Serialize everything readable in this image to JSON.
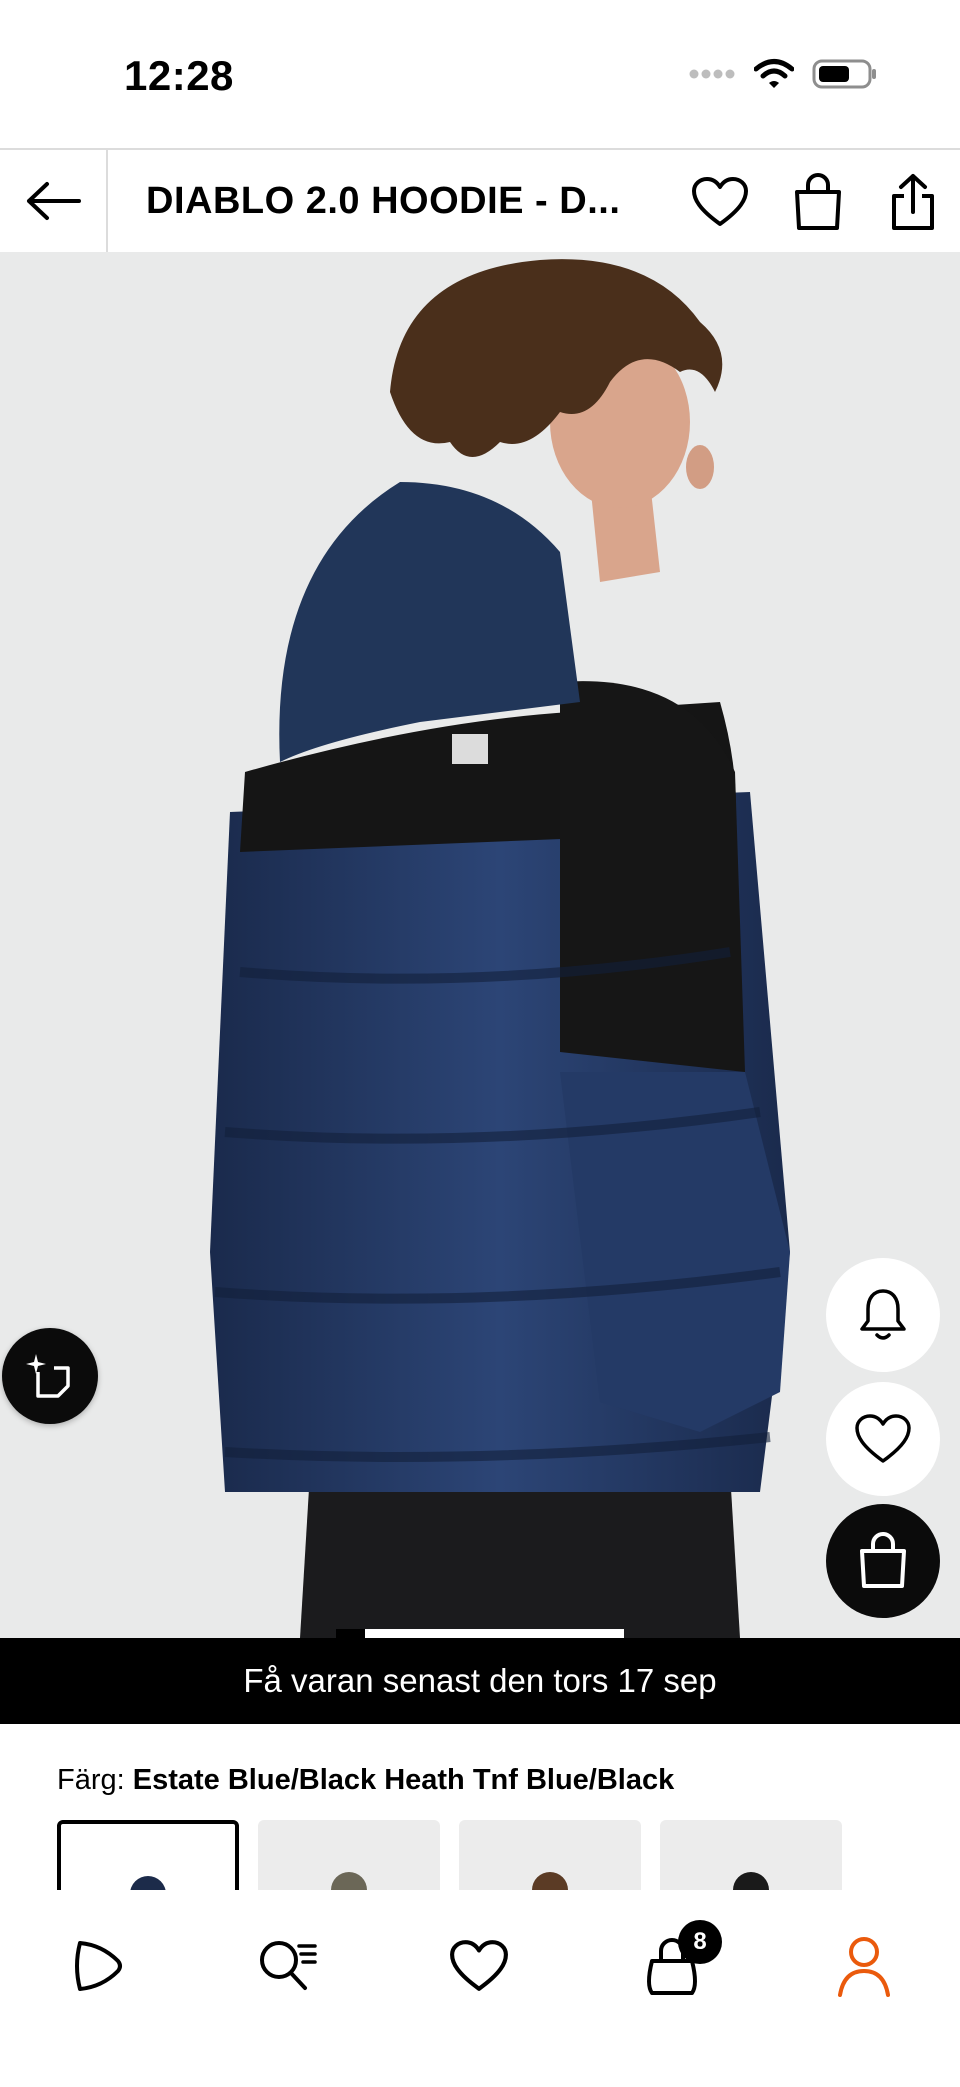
{
  "status_bar": {
    "time": "12:28"
  },
  "header": {
    "title": "DIABLO 2.0 HOODIE - D..."
  },
  "delivery_banner": "Få varan senast den tors 17 sep",
  "color": {
    "label": "Färg:",
    "value": "Estate Blue/Black Heath Tnf Blue/Black"
  },
  "colors": {
    "accent": "#ea5a0c",
    "jacket_navy": "#1e3157",
    "jacket_black": "#161616"
  },
  "gallery": {
    "current_index": 1,
    "progress": 0.9
  },
  "swatch_colors": [
    "#1c2b4a",
    "#6b6757",
    "#5b3b25",
    "#1a1a1a"
  ],
  "bottom_nav": {
    "cart_count": "8"
  },
  "icons": {
    "back": "arrow-left-icon",
    "favorite": "heart-icon",
    "bag": "shopping-bag-icon",
    "share": "share-icon",
    "visual_search": "visual-search-icon",
    "notify": "bell-icon",
    "home": "play-icon",
    "search": "search-list-icon",
    "wishlist": "heart-icon",
    "cart": "cart-icon",
    "profile": "person-icon"
  }
}
